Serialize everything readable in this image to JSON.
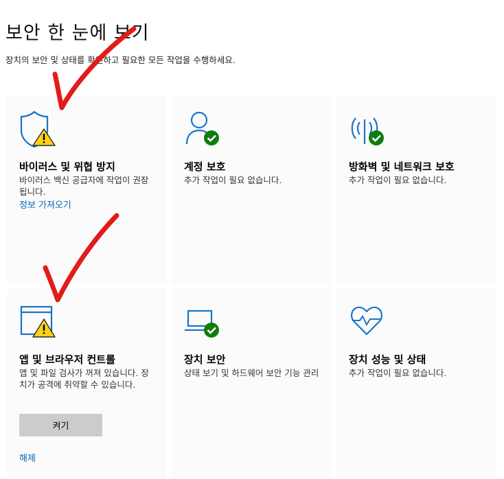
{
  "header": {
    "title": "보안 한 눈에 보기",
    "subtitle": "장치의 보안 및 상태를 확인하고 필요한 모든 작업을 수행하세요."
  },
  "cards": [
    {
      "icon": "shield-warning-icon",
      "status": "warning",
      "title": "바이러스 및 위협 방지",
      "description": "바이러스 백신 공급자에 작업이 권장됩니다.",
      "link": "정보 가져오기"
    },
    {
      "icon": "account-check-icon",
      "status": "ok",
      "title": "계정 보호",
      "description": "추가 작업이 필요 없습니다."
    },
    {
      "icon": "network-check-icon",
      "status": "ok",
      "title": "방화벽 및 네트워크 보호",
      "description": "추가 작업이 필요 없습니다."
    },
    {
      "icon": "browser-warning-icon",
      "status": "warning",
      "title": "앱 및 브라우저 컨트롤",
      "description": "앱 및 파일 검사가 꺼져 있습니다. 장치가 공격에 취약할 수 있습니다.",
      "button": "켜기",
      "link": "해제"
    },
    {
      "icon": "laptop-check-icon",
      "status": "ok",
      "title": "장치 보안",
      "description": "상태 보기 및 하드웨어 보안 기능 관리"
    },
    {
      "icon": "heart-pulse-icon",
      "status": "ok",
      "title": "장치 성능 및 상태",
      "description": "추가 작업이 필요 없습니다."
    }
  ],
  "colors": {
    "accent": "#0067b8",
    "icon_blue": "#1a73c8",
    "ok_green": "#107c10",
    "warning_yellow": "#fcd116",
    "annotation_red": "#e21b1b"
  }
}
